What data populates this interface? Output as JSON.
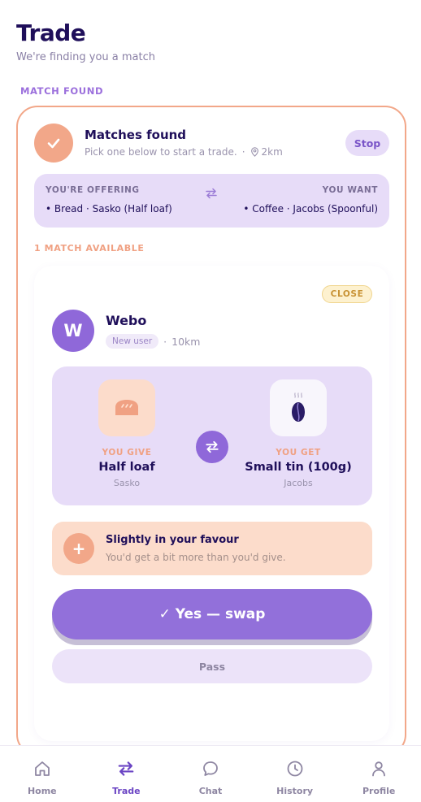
{
  "header": {
    "title": "Trade",
    "subtitle": "We're finding you a match"
  },
  "section_label": "MATCH FOUND",
  "status": {
    "title": "Matches found",
    "detail": "Pick one below to start a trade.",
    "distance": "2km",
    "stop_label": "Stop"
  },
  "summary": {
    "offering_label": "YOU'RE OFFERING",
    "offering_item": "• Bread · Sasko (Half loaf)",
    "want_label": "YOU WANT",
    "want_item": "• Coffee · Jacobs (Spoonful)"
  },
  "available_label": "1 MATCH AVAILABLE",
  "match": {
    "close_label": "CLOSE",
    "avatar_initial": "W",
    "user_name": "Webo",
    "user_badge": "New user",
    "user_distance": "10km",
    "give": {
      "role": "YOU GIVE",
      "item": "Half loaf",
      "brand": "Sasko"
    },
    "get": {
      "role": "YOU GET",
      "item": "Small tin (100g)",
      "brand": "Jacobs"
    },
    "fairness": {
      "symbol": "+",
      "title": "Slightly in your favour",
      "detail": "You'd get a bit more than you'd give."
    },
    "yes_label": "✓ Yes — swap",
    "pass_label": "Pass"
  },
  "nav": {
    "active": "Trade",
    "items": [
      {
        "label": "Home",
        "icon": "home-icon"
      },
      {
        "label": "Trade",
        "icon": "swap-icon"
      },
      {
        "label": "Chat",
        "icon": "chat-icon"
      },
      {
        "label": "History",
        "icon": "clock-icon"
      },
      {
        "label": "Profile",
        "icon": "user-icon"
      }
    ]
  },
  "colors": {
    "primary": "#9270da",
    "accent": "#f2a789",
    "lavender": "#e7dcf8",
    "peach": "#fcdccb",
    "ink": "#1f0f5a"
  }
}
